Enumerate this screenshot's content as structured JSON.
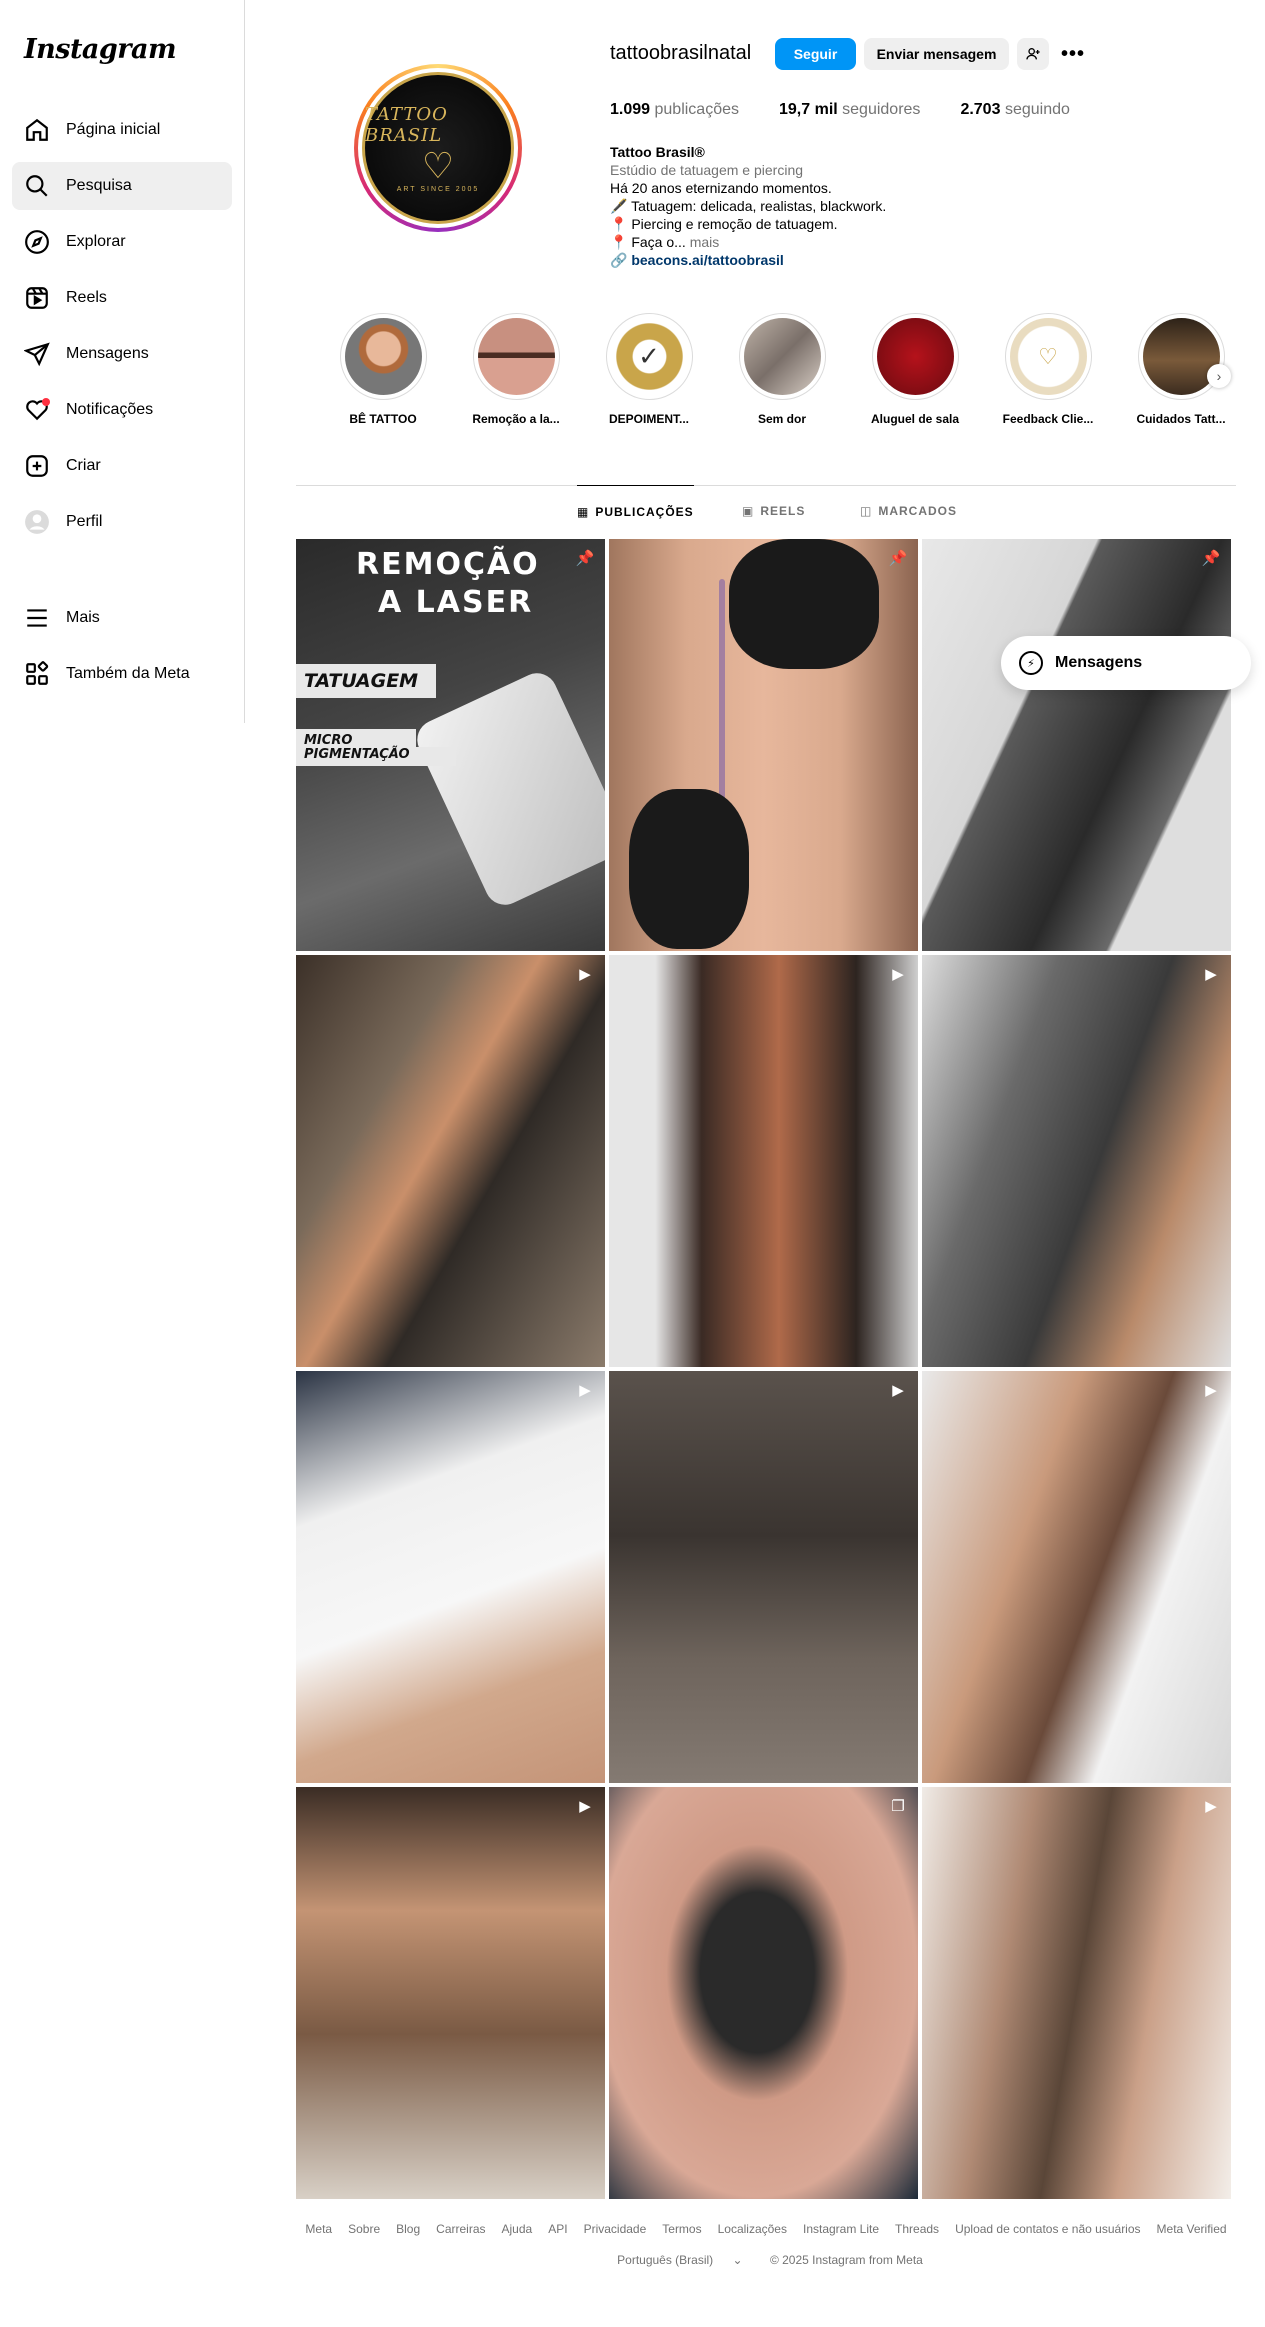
{
  "app": {
    "logo": "Instagram"
  },
  "sidebar": {
    "items": [
      {
        "label": "Página inicial",
        "icon": "home-icon"
      },
      {
        "label": "Pesquisa",
        "icon": "search-icon"
      },
      {
        "label": "Explorar",
        "icon": "compass-icon"
      },
      {
        "label": "Reels",
        "icon": "reels-icon"
      },
      {
        "label": "Mensagens",
        "icon": "send-icon"
      },
      {
        "label": "Notificações",
        "icon": "heart-icon"
      },
      {
        "label": "Criar",
        "icon": "plus-square-icon"
      },
      {
        "label": "Perfil",
        "icon": "avatar-icon"
      }
    ],
    "bottom": [
      {
        "label": "Mais",
        "icon": "menu-icon"
      },
      {
        "label": "Também da Meta",
        "icon": "meta-apps-icon"
      }
    ]
  },
  "profile": {
    "username": "tattoobrasilnatal",
    "follow_label": "Seguir",
    "message_label": "Enviar mensagem",
    "more_label": "•••",
    "stats": {
      "posts_value": "1.099",
      "posts_label": "publicações",
      "followers_value": "19,7 mil",
      "followers_label": "seguidores",
      "following_value": "2.703",
      "following_label": "seguindo"
    },
    "pic_brand": "TATTOO BRASIL",
    "pic_since": "ART SINCE 2005",
    "bio": {
      "name": "Tattoo Brasil®",
      "category": "Estúdio de tatuagem e piercing",
      "line1": "Há 20 anos eternizando momentos.",
      "line2": "🖋️ Tatuagem: delicada, realistas, blackwork.",
      "line3": "📍 Piercing e remoção de tatuagem.",
      "line4": "📍 Faça o...",
      "more": "mais",
      "link": "beacons.ai/tattoobrasil"
    }
  },
  "highlights": [
    {
      "label": "BÊ TATTOO"
    },
    {
      "label": "Remoção a la..."
    },
    {
      "label": "DEPOIMENT..."
    },
    {
      "label": "Sem dor"
    },
    {
      "label": "Aluguel de sala"
    },
    {
      "label": "Feedback Clie..."
    },
    {
      "label": "Cuidados Tatt..."
    }
  ],
  "tabs": [
    {
      "label": "PUBLICAÇÕES",
      "icon": "grid-icon",
      "active": true
    },
    {
      "label": "REELS",
      "icon": "reels-icon",
      "active": false
    },
    {
      "label": "MARCADOS",
      "icon": "tagged-icon",
      "active": false
    }
  ],
  "posts": [
    {
      "type": "pinned",
      "text1": "REMOÇÃO",
      "text2": "A LASER",
      "text3": "TATUAGEM",
      "text4": "MICRO",
      "text5": "PIGMENTAÇÃO"
    },
    {
      "type": "pinned"
    },
    {
      "type": "pinned"
    },
    {
      "type": "reel"
    },
    {
      "type": "reel"
    },
    {
      "type": "reel"
    },
    {
      "type": "reel"
    },
    {
      "type": "reel"
    },
    {
      "type": "reel"
    },
    {
      "type": "reel"
    },
    {
      "type": "carousel"
    },
    {
      "type": "reel"
    }
  ],
  "messages_pill": {
    "label": "Mensagens"
  },
  "footer": {
    "links": [
      "Meta",
      "Sobre",
      "Blog",
      "Carreiras",
      "Ajuda",
      "API",
      "Privacidade",
      "Termos",
      "Localizações",
      "Instagram Lite",
      "Threads",
      "Upload de contatos e não usuários",
      "Meta Verified"
    ],
    "language": "Português (Brasil)",
    "copyright": "© 2025 Instagram from Meta"
  }
}
